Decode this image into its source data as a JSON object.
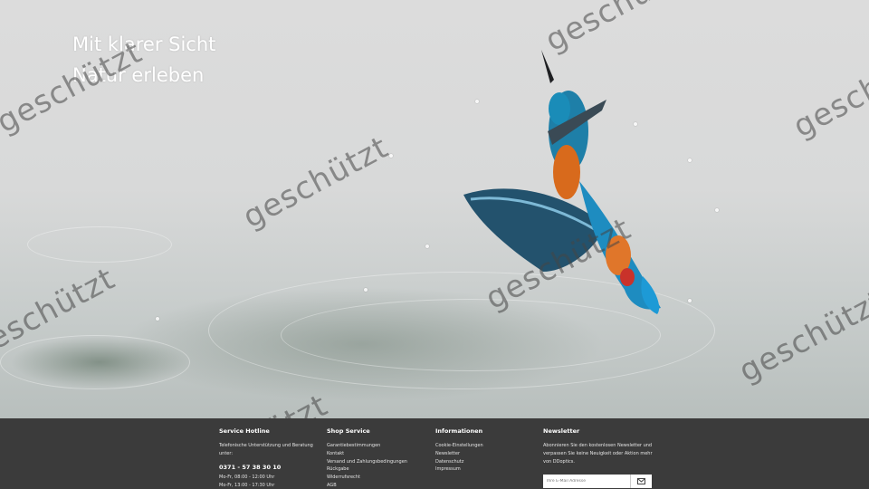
{
  "hero": {
    "title_line1": "Mit klarer Sicht",
    "title_line2": "Natur erleben",
    "image_icon": "kingfisher-diving-photo"
  },
  "watermark": {
    "text": "geschützt"
  },
  "footer": {
    "service": {
      "heading": "Service Hotline",
      "description": "Telefonische Unterstützung und Beratung unter:",
      "phone": "0371 - 57 38 30 10",
      "hours1": "Mo-Fr, 08:00 - 12:00 Uhr",
      "hours2": "Mo-Fr, 13:00 - 17:30 Uhr"
    },
    "shop": {
      "heading": "Shop Service",
      "links": [
        "Garantiebestimmungen",
        "Kontakt",
        "Versand und Zahlungsbedingungen",
        "Rückgabe",
        "Widerrufsrecht",
        "AGB"
      ]
    },
    "info": {
      "heading": "Informationen",
      "links": [
        "Cookie-Einstellungen",
        "Newsletter",
        "Datenschutz",
        "Impressum"
      ]
    },
    "newsletter": {
      "heading": "Newsletter",
      "description": "Abonnieren Sie den kostenlosen Newsletter und verpassen Sie keine Neuigkeit oder Aktion mehr von DDoptics.",
      "placeholder": "Ihre E-Mail Adresse",
      "button_icon": "envelope-icon"
    }
  },
  "colors": {
    "footer_bg": "#3b3b3b",
    "hero_text": "#ffffff"
  }
}
